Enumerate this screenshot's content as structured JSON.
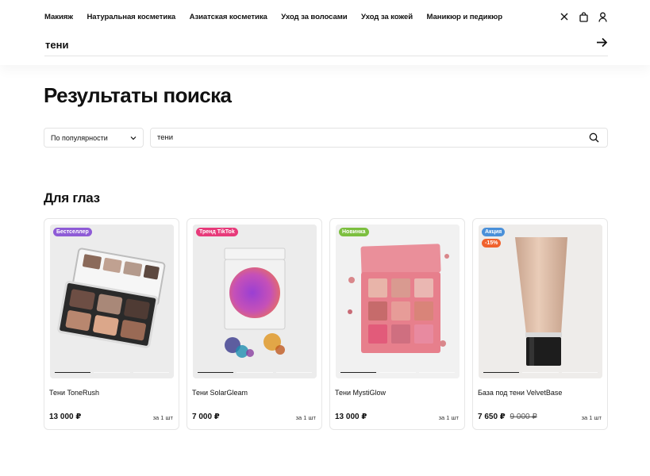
{
  "nav": {
    "items": [
      {
        "label": "Макияж"
      },
      {
        "label": "Натуральная косметика"
      },
      {
        "label": "Азиатская косметика"
      },
      {
        "label": "Уход за волосами"
      },
      {
        "label": "Уход за кожей"
      },
      {
        "label": "Маникюр и педикюр"
      }
    ],
    "icons": [
      "close-icon",
      "bag-icon",
      "user-icon"
    ]
  },
  "search": {
    "query": "тени",
    "submit_icon": "arrow-right-icon"
  },
  "page": {
    "title": "Результаты поиска"
  },
  "filters": {
    "sort_label": "По популярности",
    "search_value": "тени",
    "search_icon": "search-icon"
  },
  "section": {
    "title": "Для глаз"
  },
  "products": [
    {
      "name": "Тени ToneRush",
      "price": "13 000 ₽",
      "old_price": "",
      "unit": "за 1 шт",
      "badge": "Бестселлер",
      "badge_color": "#8e5bd6",
      "badge2": "",
      "badge2_color": ""
    },
    {
      "name": "Тени SolarGleam",
      "price": "7 000 ₽",
      "old_price": "",
      "unit": "за 1 шт",
      "badge": "Тренд TikTok",
      "badge_color": "#e73a7a",
      "badge2": "",
      "badge2_color": ""
    },
    {
      "name": "Тени MystiGlow",
      "price": "13 000 ₽",
      "old_price": "",
      "unit": "за 1 шт",
      "badge": "Новинка",
      "badge_color": "#7cbf3f",
      "badge2": "",
      "badge2_color": ""
    },
    {
      "name": "База под тени VelvetBase",
      "price": "7 650 ₽",
      "old_price": "9 000 ₽",
      "unit": "за 1 шт",
      "badge": "Акция",
      "badge_color": "#4a90d9",
      "badge2": "-15%",
      "badge2_color": "#f0622d"
    }
  ]
}
